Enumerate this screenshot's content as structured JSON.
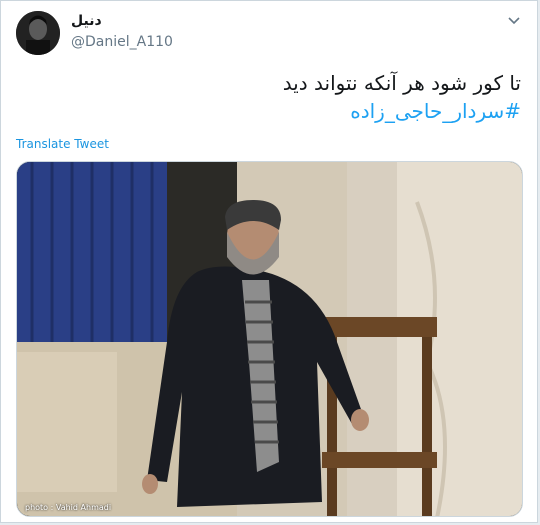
{
  "tweet": {
    "display_name": "دنیل",
    "handle": "@Daniel_A110",
    "text_line1": "تا کور شود هر آنکه نتواند دید",
    "hashtag": "#سردار_حاجی_زاده",
    "translate_label": "Translate Tweet"
  },
  "media": {
    "photo_credit": "photo : Vahid Ahmadi"
  },
  "icons": {
    "menu": "chevron-down-icon",
    "avatar": "avatar-portrait"
  },
  "colors": {
    "link": "#1da1f2",
    "text": "#14171a",
    "muted": "#657786"
  }
}
